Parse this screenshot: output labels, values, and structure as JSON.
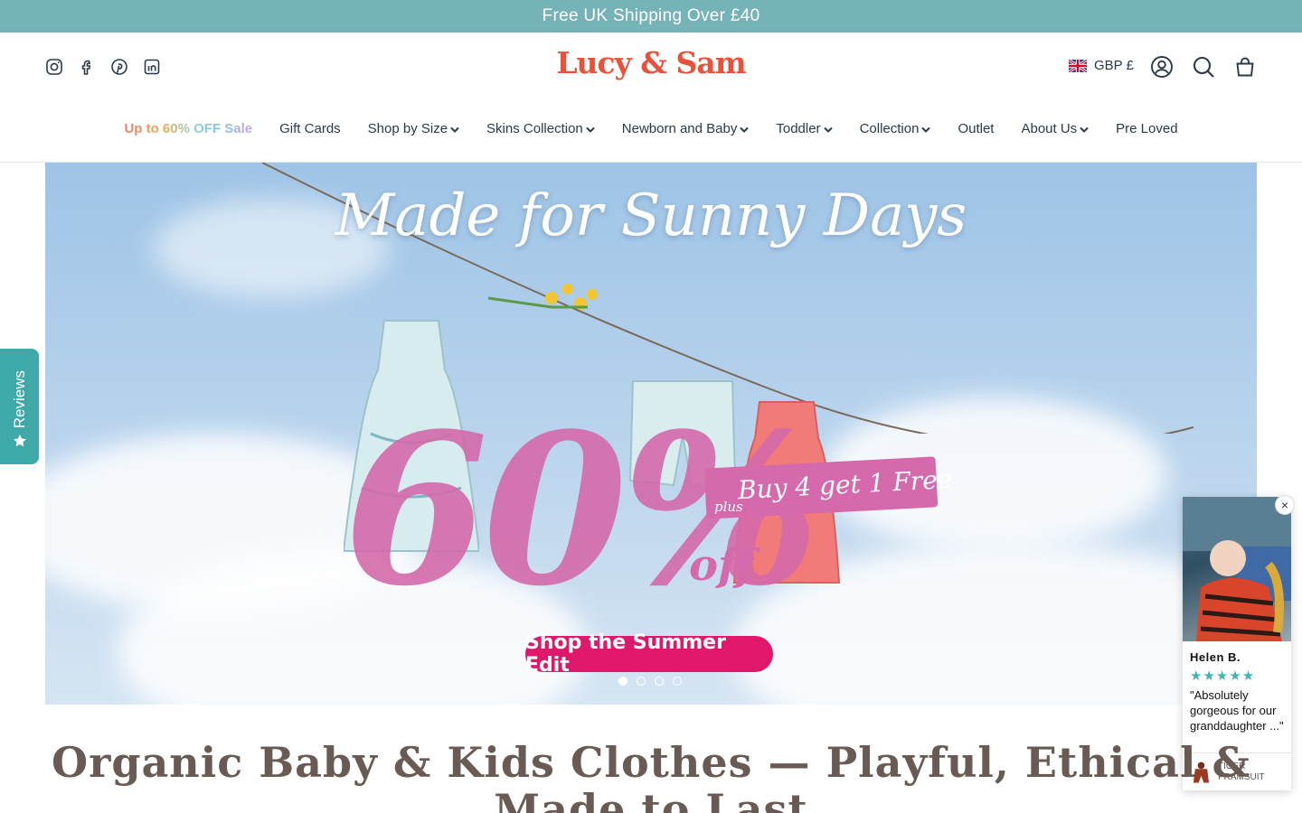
{
  "announcement": "Free UK Shipping Over £40",
  "brand": "Lucy & Sam",
  "social_icons": [
    "instagram-icon",
    "facebook-icon",
    "pinterest-icon",
    "linkedin-icon"
  ],
  "currency": "GBP £",
  "header_icons": [
    "account-icon",
    "search-icon",
    "cart-icon"
  ],
  "nav": {
    "sale": "Up to 60% OFF Sale",
    "items": [
      {
        "label": "Gift Cards",
        "dropdown": false
      },
      {
        "label": "Shop by Size",
        "dropdown": true
      },
      {
        "label": "Skins Collection",
        "dropdown": true
      },
      {
        "label": "Newborn and Baby",
        "dropdown": true
      },
      {
        "label": "Toddler",
        "dropdown": true
      },
      {
        "label": "Collection",
        "dropdown": true
      },
      {
        "label": "Outlet",
        "dropdown": false
      },
      {
        "label": "About Us",
        "dropdown": true
      },
      {
        "label": "Pre Loved",
        "dropdown": false
      }
    ]
  },
  "hero": {
    "headline": "Made for Sunny Days",
    "discount": "60%",
    "discount_suffix": "off",
    "promo_plus": "plus",
    "promo": "Buy 4 get 1 Free",
    "cta": "Shop the Summer Edit",
    "slide_count": 4,
    "active_slide": 1
  },
  "reviews_tab": "Reviews",
  "review_popup": {
    "name": "Helen B.",
    "rating": 5,
    "quote": "\"Absolutely gorgeous for our granddaughter ...\"",
    "product": "TIGER PRAMSUIT",
    "close": "×"
  },
  "page_title": "Organic Baby & Kids Clothes — Playful, Ethical & Made to Last",
  "colors": {
    "announcement_bg": "#76b3b8",
    "brand": "#e8523a",
    "cta": "#e0186b",
    "accent_pink": "#d46aab",
    "reviews_tab": "#3fa8a8"
  }
}
